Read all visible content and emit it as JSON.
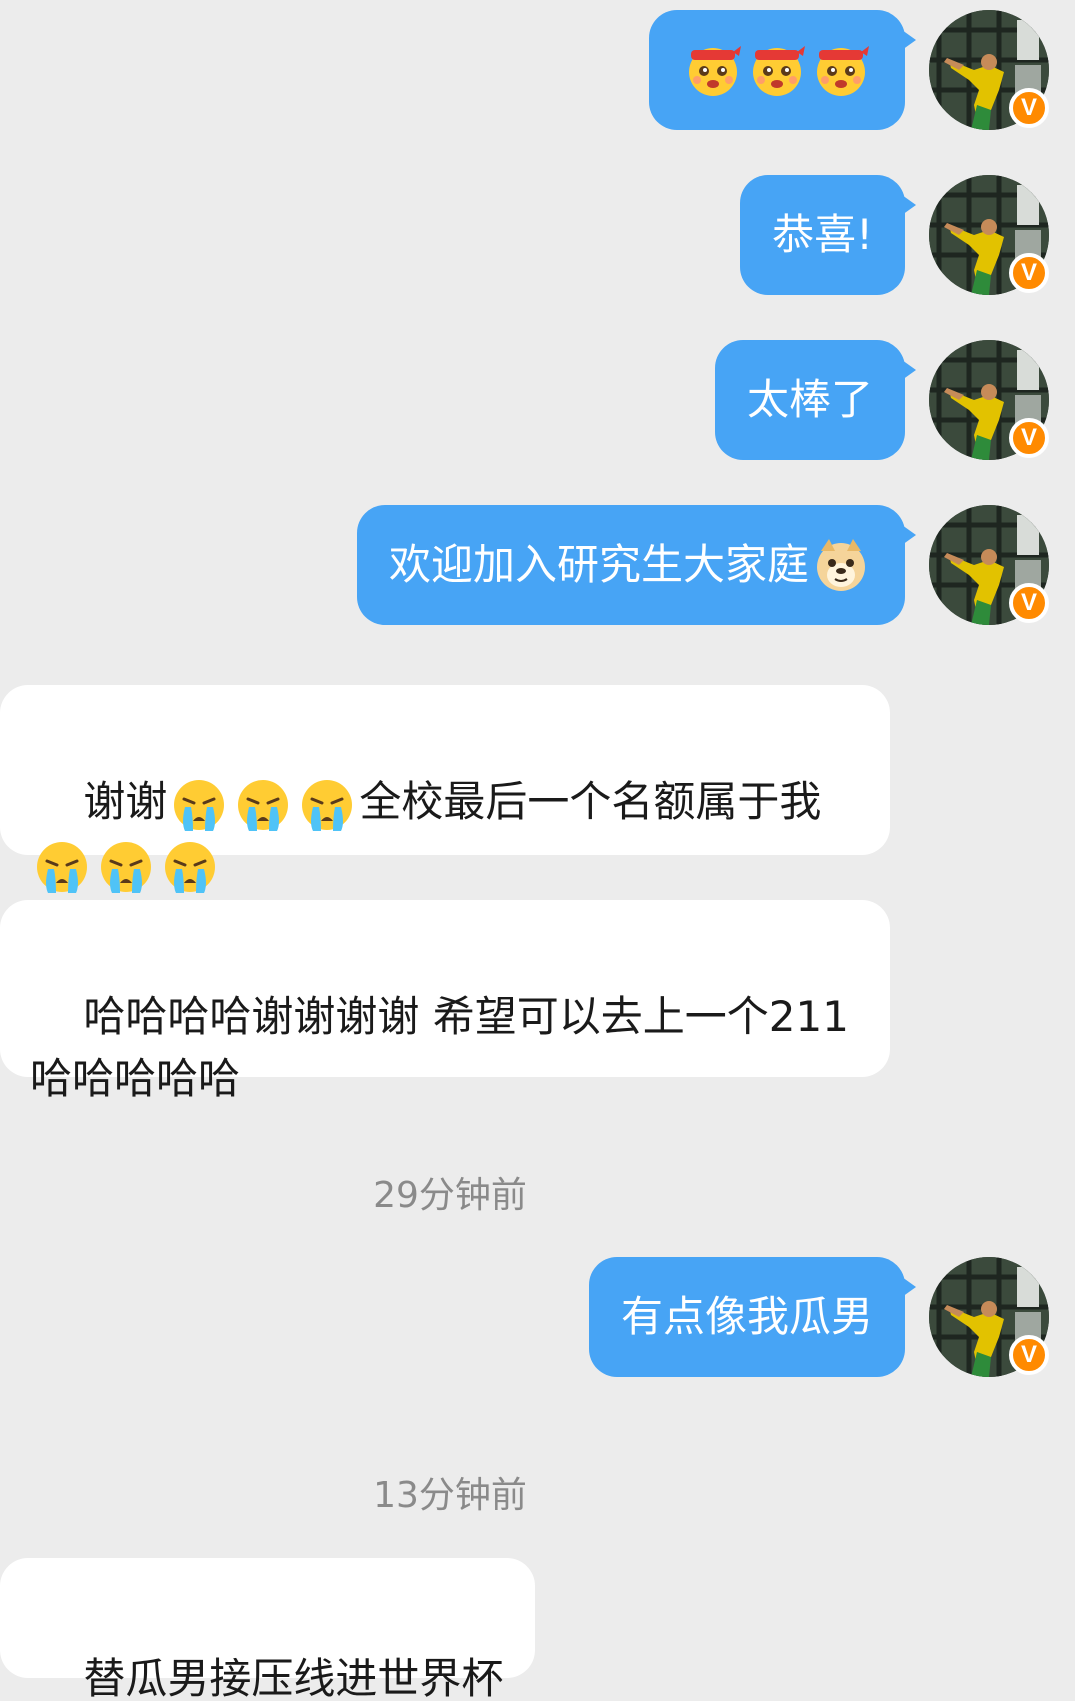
{
  "messages": [
    {
      "id": "m1",
      "direction": "out",
      "emoji": [
        "celebrate-headband-emoji",
        "celebrate-headband-emoji",
        "celebrate-headband-emoji"
      ]
    },
    {
      "id": "m2",
      "direction": "out",
      "text": "恭喜!"
    },
    {
      "id": "m3",
      "direction": "out",
      "text": "太棒了"
    },
    {
      "id": "m4",
      "direction": "out",
      "text": "欢迎加入研究生大家庭",
      "trailing_emoji": "doge-emoji"
    },
    {
      "id": "m5",
      "direction": "in",
      "text_a": "谢谢",
      "text_b": "全校最后一个名额属于我",
      "emoji_count_a": 3,
      "emoji_count_b": 3,
      "emoji": "crying-emoji"
    },
    {
      "id": "m6",
      "direction": "in",
      "text": "哈哈哈哈谢谢谢谢 希望可以去上一个211哈哈哈哈哈"
    },
    {
      "id": "t1",
      "type": "timestamp",
      "text": "29分钟前"
    },
    {
      "id": "m7",
      "direction": "out",
      "text": "有点像我瓜男"
    },
    {
      "id": "t2",
      "type": "timestamp",
      "text": "13分钟前"
    },
    {
      "id": "m8",
      "direction": "in",
      "text": "替瓜男接压线进世界杯"
    }
  ],
  "avatar": {
    "badge": "V",
    "badge_color": "#ff8a00"
  },
  "colors": {
    "outgoing_bubble": "#47a4f5",
    "incoming_bubble": "#ffffff",
    "background": "#ececec",
    "timestamp": "#8a8a8a"
  }
}
